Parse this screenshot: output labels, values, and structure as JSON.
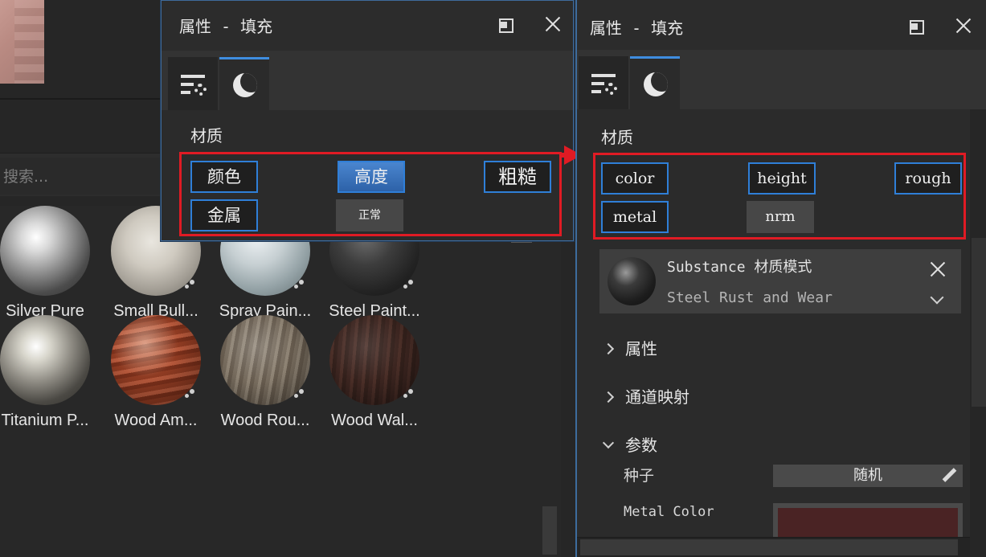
{
  "shelf": {
    "search_placeholder": "搜索...",
    "materials_row1": [
      "Silver Pure",
      "Small Bull...",
      "Spray Pain...",
      "Steel Paint..."
    ],
    "materials_row2": [
      "Titanium P...",
      "Wood Am...",
      "Wood Rou...",
      "Wood Wal..."
    ]
  },
  "left_panel": {
    "title": "属性 - 填充",
    "section": "材质",
    "channels": {
      "color": "颜色",
      "height": "高度",
      "rough": "粗糙",
      "metal": "金属",
      "nrm": "正常"
    }
  },
  "right_panel": {
    "title": "属性 - 填充",
    "section": "材质",
    "channels": {
      "color": "color",
      "height": "height",
      "rough": "rough",
      "metal": "metal",
      "nrm": "nrm"
    },
    "substance": {
      "title": "Substance 材质模式",
      "name": "Steel Rust and Wear"
    },
    "groups": {
      "properties": "属性",
      "channel_mapping": "通道映射",
      "parameters": "参数"
    },
    "params": {
      "seed_label": "种子",
      "seed_button": "随机",
      "metal_color_label": "Metal Color",
      "metal_color_value": "#4a2324"
    }
  },
  "colors": {
    "accent": "#2f7fd8",
    "highlight_box": "#e01b24",
    "active_tab": "#3f8de0"
  },
  "icons": [
    "restore-icon",
    "close-icon",
    "settings-list-icon",
    "material-sphere-icon",
    "pencil-icon",
    "chevron-right-icon",
    "chevron-down-icon",
    "arrow-marker"
  ]
}
